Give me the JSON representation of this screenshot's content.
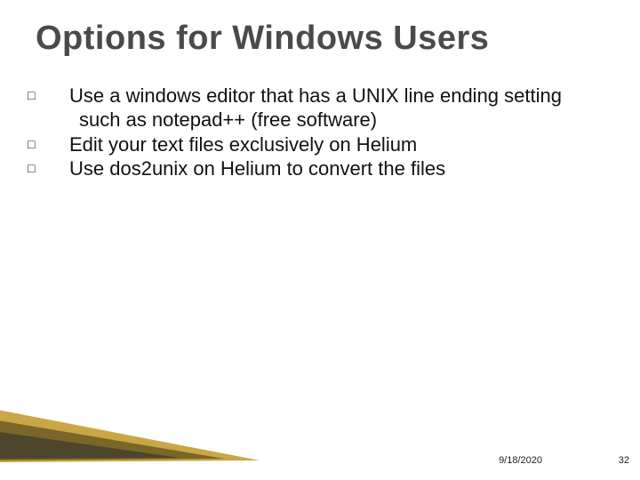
{
  "title": "Options for Windows Users",
  "bullets": [
    "Use a windows editor that has a UNIX line ending setting such as notepad++ (free software)",
    "Edit your text files exclusively on Helium",
    "Use dos2unix on Helium to convert the files"
  ],
  "footer": {
    "date": "9/18/2020",
    "page": "32"
  },
  "bullet_glyph": "□"
}
